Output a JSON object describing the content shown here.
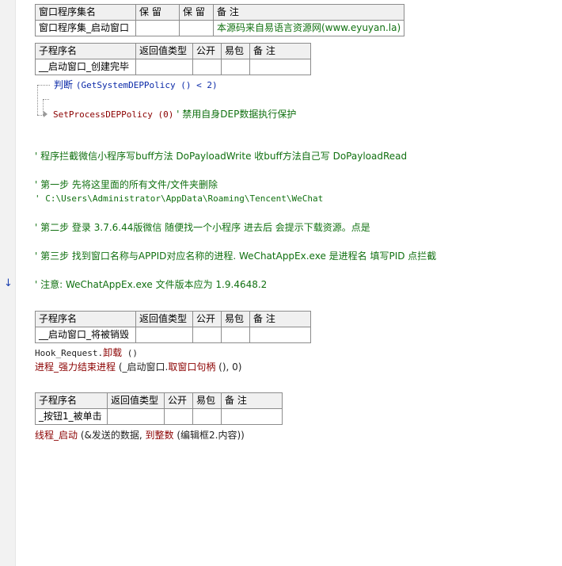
{
  "assembly_table": {
    "headers": [
      "窗口程序集名",
      "保 留",
      "保 留",
      "备 注"
    ],
    "row": [
      "窗口程序集_启动窗口",
      "",
      "",
      "本源码来自易语言资源网(www.eyuyan.la)"
    ]
  },
  "sub_headers": [
    "子程序名",
    "返回值类型",
    "公开",
    "易包",
    "备 注"
  ],
  "sub1": {
    "name": "__启动窗口_创建完毕"
  },
  "code1": {
    "if_keyword": "判断",
    "if_expr": "(GetSystemDEPPolicy () < 2)",
    "call": "SetProcessDEPPolicy (0)",
    "call_comment": "' 禁用自身DEP数据执行保护"
  },
  "comments": [
    "' 程序拦截微信小程序写buff方法 DoPayloadWrite  收buff方法自己写 DoPayloadRead",
    "' 第一步 先将这里面的所有文件/文件夹删除",
    "' C:\\Users\\Administrator\\AppData\\Roaming\\Tencent\\WeChat",
    "' 第二步 登录 3.7.6.44版微信 随便找一个小程序 进去后 会提示下载资源。点是",
    "' 第三步 找到窗口名称与APPID对应名称的进程. WeChatAppEx.exe 是进程名 填写PID 点拦截",
    "' 注意: WeChatAppEx.exe 文件版本应为 1.9.4648.2"
  ],
  "sub2": {
    "name": "__启动窗口_将被销毁"
  },
  "code2": {
    "line1_a": "Hook_Request.",
    "line1_b": "卸载",
    "line1_c": " ()",
    "line2_a": "进程_强力结束进程",
    "line2_b": " (_启动窗口.",
    "line2_c": "取窗口句柄",
    "line2_d": " (), 0)"
  },
  "sub3": {
    "name": "_按钮1_被单击"
  },
  "code3": {
    "a": "线程_启动",
    "b": " (&发送的数据, ",
    "c": "到整数",
    "d": " (编辑框2.内容))"
  },
  "icons": {
    "gutter_arrow": "arrow-down-icon"
  }
}
